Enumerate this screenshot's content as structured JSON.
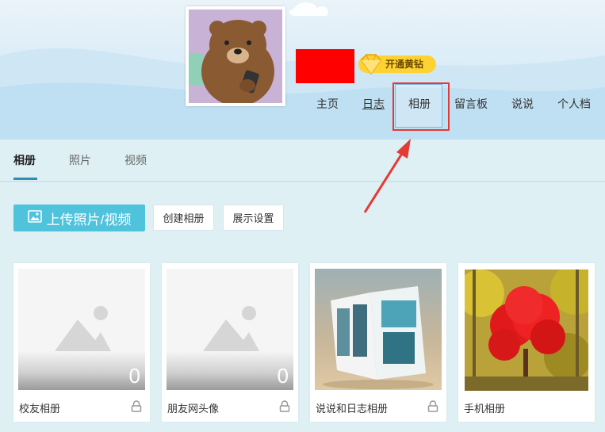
{
  "profile": {
    "vip_label": "开通黄钻"
  },
  "nav": {
    "items": [
      {
        "label": "主页"
      },
      {
        "label": "日志"
      },
      {
        "label": "相册"
      },
      {
        "label": "留言板"
      },
      {
        "label": "说说"
      },
      {
        "label": "个人档"
      }
    ],
    "active": "相册"
  },
  "subtabs": {
    "items": [
      {
        "label": "相册"
      },
      {
        "label": "照片"
      },
      {
        "label": "视频"
      }
    ],
    "active": "相册"
  },
  "toolbar": {
    "upload_label": "上传照片/视频",
    "create_label": "创建相册",
    "display_label": "展示设置"
  },
  "albums": [
    {
      "title": "校友相册",
      "count": "0",
      "locked": true
    },
    {
      "title": "朋友网头像",
      "count": "0",
      "locked": true
    },
    {
      "title": "说说和日志相册",
      "locked": true
    },
    {
      "title": "手机相册",
      "locked": false
    }
  ],
  "colors": {
    "accent": "#50c3dc",
    "highlight_frame": "#e53935",
    "arrow": "#e53935",
    "redacted": "#ff0000",
    "vip": "#ffd233"
  }
}
